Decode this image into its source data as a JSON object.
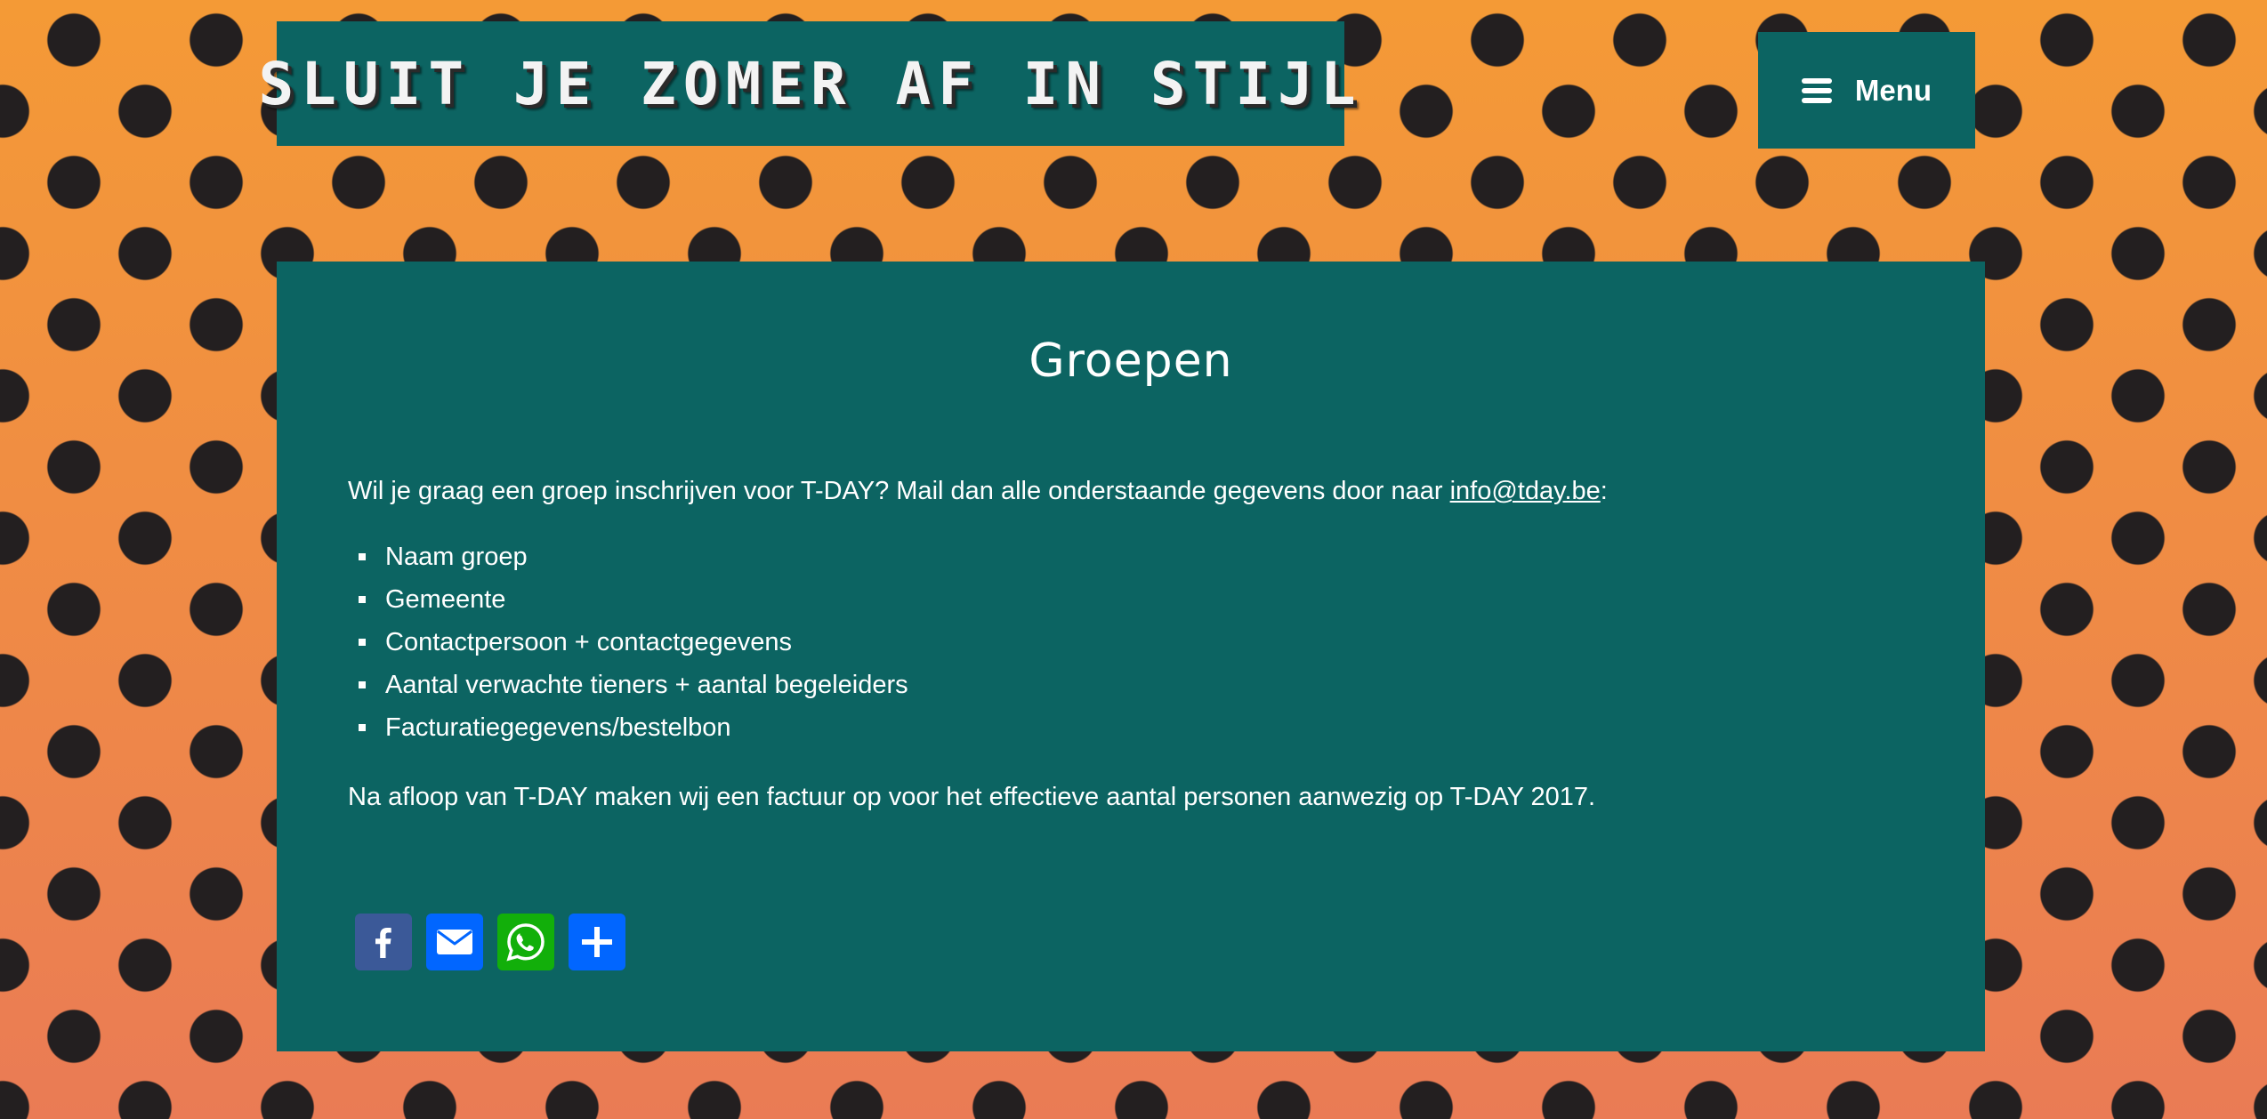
{
  "header": {
    "site_title": "SLUIT JE ZOMER AF IN STIJL",
    "menu_label": "Menu"
  },
  "page": {
    "title": "Groepen",
    "intro_before_link": "Wil je graag een groep inschrijven voor T-DAY? Mail dan alle onderstaande gegevens door naar ",
    "email_link": "info@tday.be",
    "intro_after_link": ":",
    "list_items": [
      "Naam groep",
      "Gemeente",
      "Contactpersoon + contactgegevens",
      "Aantal verwachte tieners + aantal begeleiders",
      "Facturatiegegevens/bestelbon"
    ],
    "outro": "Na afloop van T-DAY maken wij een factuur op voor het effectieve aantal personen aanwezig op T-DAY 2017."
  },
  "share": {
    "buttons": [
      {
        "icon": "facebook-icon",
        "color": "#3b5998"
      },
      {
        "icon": "email-icon",
        "color": "#0166ff"
      },
      {
        "icon": "whatsapp-icon",
        "color": "#12af0a"
      },
      {
        "icon": "share-plus-icon",
        "color": "#0166ff"
      }
    ]
  },
  "colors": {
    "panel": "#0c6462",
    "background_orange": "#f29440",
    "dots": "#231f20"
  }
}
